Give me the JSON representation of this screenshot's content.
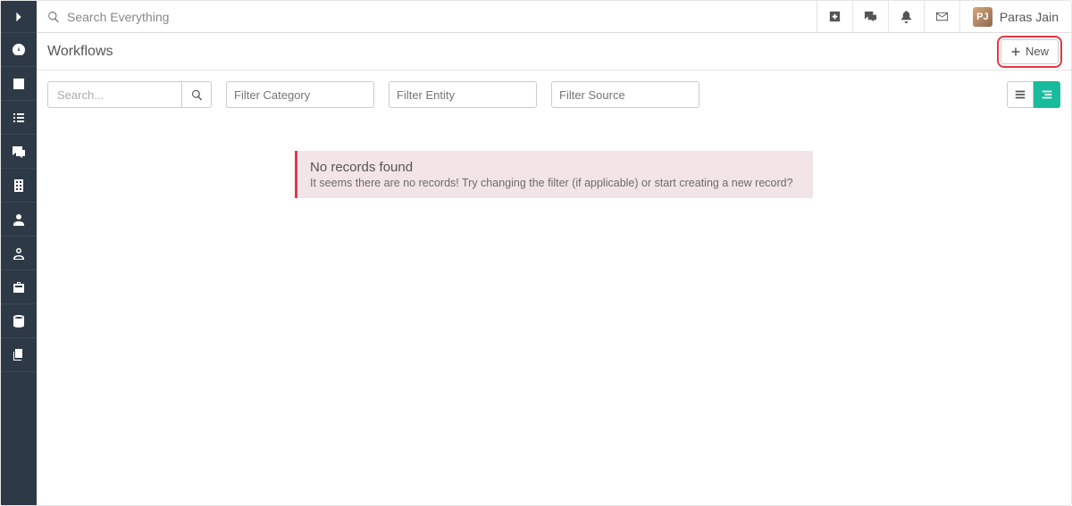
{
  "topbar": {
    "search_placeholder": "Search Everything",
    "user_name": "Paras Jain"
  },
  "page": {
    "title": "Workflows",
    "new_label": "New"
  },
  "filters": {
    "search_placeholder": "Search...",
    "category_placeholder": "Filter Category",
    "entity_placeholder": "Filter Entity",
    "source_placeholder": "Filter Source"
  },
  "alert": {
    "title": "No records found",
    "text": "It seems there are no records! Try changing the filter (if applicable) or start creating a new record?"
  },
  "sidebar": {
    "items": [
      {
        "icon": "chevron-right"
      },
      {
        "icon": "dashboard"
      },
      {
        "icon": "calendar-check"
      },
      {
        "icon": "list"
      },
      {
        "icon": "chat"
      },
      {
        "icon": "building"
      },
      {
        "icon": "user"
      },
      {
        "icon": "user-outline"
      },
      {
        "icon": "briefcase"
      },
      {
        "icon": "database"
      },
      {
        "icon": "copy"
      }
    ]
  }
}
